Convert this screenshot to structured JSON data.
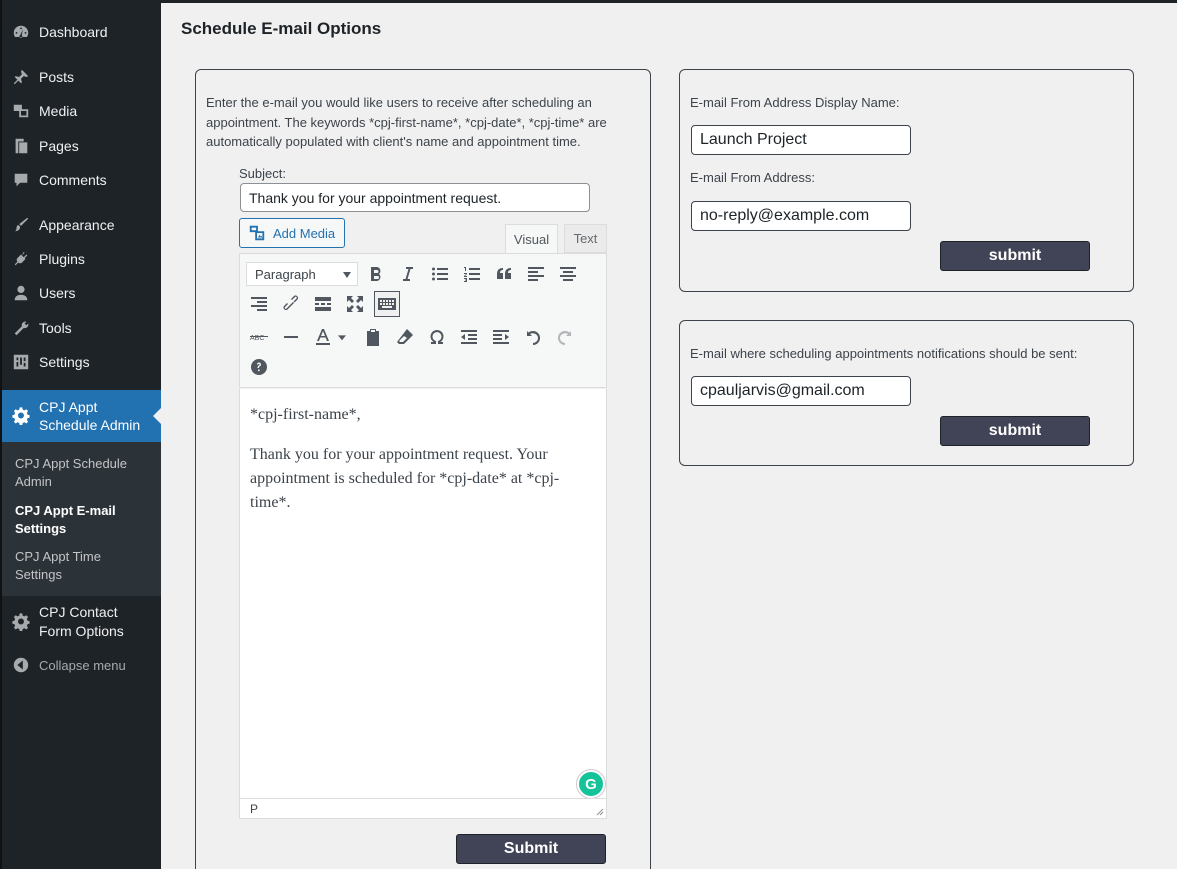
{
  "sidebar": {
    "items": [
      {
        "label": "Dashboard",
        "icon": "dashboard-icon"
      },
      {
        "label": "Posts",
        "icon": "pin-icon"
      },
      {
        "label": "Media",
        "icon": "media-icon"
      },
      {
        "label": "Pages",
        "icon": "pages-icon"
      },
      {
        "label": "Comments",
        "icon": "comment-icon"
      },
      {
        "label": "Appearance",
        "icon": "brush-icon"
      },
      {
        "label": "Plugins",
        "icon": "plugin-icon"
      },
      {
        "label": "Users",
        "icon": "user-icon"
      },
      {
        "label": "Tools",
        "icon": "wrench-icon"
      },
      {
        "label": "Settings",
        "icon": "settings-sliders-icon"
      }
    ],
    "current": {
      "label_line1": "CPJ Appt",
      "label_line2": "Schedule Admin",
      "icon": "gear-icon"
    },
    "submenu": [
      {
        "line1": "CPJ Appt Schedule",
        "line2": "Admin"
      },
      {
        "line1": "CPJ Appt E-mail",
        "line2": "Settings"
      },
      {
        "line1": "CPJ Appt Time",
        "line2": "Settings"
      }
    ],
    "contact": {
      "label_line1": "CPJ Contact",
      "label_line2": "Form Options",
      "icon": "gear-icon"
    },
    "collapse_label": "Collapse menu"
  },
  "page": {
    "title": "Schedule E-mail Options"
  },
  "email_form": {
    "intro_line1": "Enter the e-mail you would like users to receive after scheduling an",
    "intro_line2": "appointment. The keywords *cpj-first-name*, *cpj-date*, *cpj-time* are",
    "intro_line3": "automatically populated with client's name and appointment time.",
    "subject_label": "Subject:",
    "subject_value": "Thank you for your appointment request.",
    "add_media_label": "Add Media",
    "tab_visual": "Visual",
    "tab_text": "Text",
    "format_select": "Paragraph",
    "body_line1": "*cpj-first-name*,",
    "body_para2": "Thank you for your appointment request. Your appointment is scheduled for *cpj-date* at *cpj-time*.",
    "status_path": "P",
    "grammarly_letter": "G",
    "submit_label": "Submit"
  },
  "from_settings": {
    "display_name_label": "E-mail From Address Display Name:",
    "display_name_value": "Launch Project",
    "from_address_label": "E-mail From Address:",
    "from_address_value": "no-reply@example.com",
    "submit_label": "submit"
  },
  "notification_settings": {
    "label": "E-mail where scheduling appointments notifications should be sent:",
    "value": "cpauljarvis@gmail.com",
    "submit_label": "submit"
  },
  "colors": {
    "sidebar_bg": "#1d2327",
    "accent": "#2271b1",
    "submit_bg": "#414456"
  }
}
